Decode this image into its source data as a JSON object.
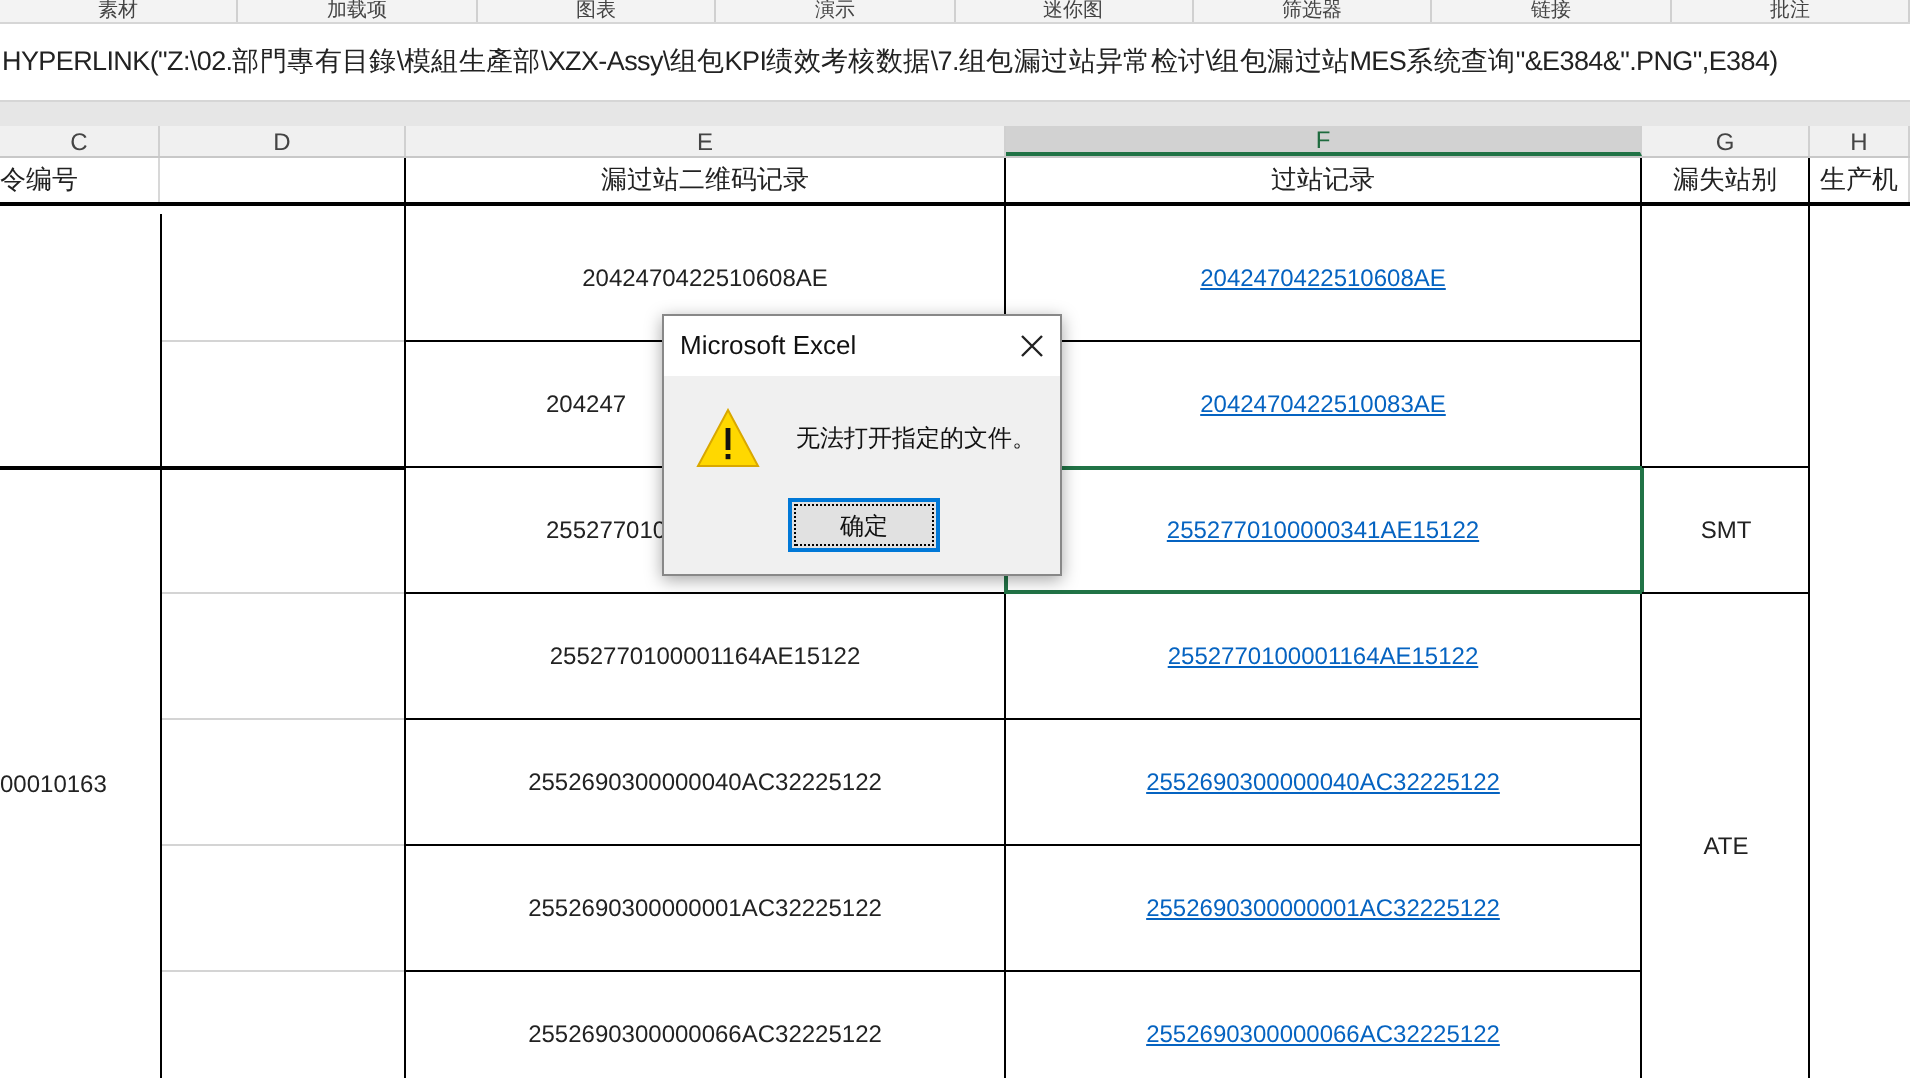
{
  "ribbon_groups": [
    "素材",
    "加载项",
    "图表",
    "演示",
    "迷你图",
    "筛选器",
    "链接",
    "批注"
  ],
  "formula_bar": {
    "value": "HYPERLINK(\"Z:\\02.部門專有目錄\\模組生產部\\XZX-Assy\\组包KPI绩效考核数据\\7.组包漏过站异常检讨\\组包漏过站MES系统查询\"&E384&\".PNG\",E384)"
  },
  "columns": [
    {
      "label": "C",
      "selected": false
    },
    {
      "label": "D",
      "selected": false
    },
    {
      "label": "E",
      "selected": false
    },
    {
      "label": "F",
      "selected": true
    },
    {
      "label": "G",
      "selected": false
    },
    {
      "label": "H",
      "selected": false
    }
  ],
  "header_row": {
    "c": "令编号",
    "e": "漏过站二维码记录",
    "f": "过站记录",
    "g": "漏失站别",
    "h": "生产机"
  },
  "rows": [
    {
      "e": "2042470422510608AE",
      "e_cut": false,
      "f": "2042470422510608AE",
      "selected": false
    },
    {
      "e": "204247",
      "e_cut": true,
      "f": "2042470422510083AE",
      "selected": false
    },
    {
      "e": "255277010",
      "e_cut": true,
      "f": "2552770100000341AE15122",
      "selected": true
    },
    {
      "e": "2552770100001164AE15122",
      "e_cut": false,
      "f": "2552770100001164AE15122",
      "selected": false
    },
    {
      "e": "2552690300000040AC32225122",
      "e_cut": false,
      "f": "2552690300000040AC32225122",
      "selected": false
    },
    {
      "e": "2552690300000001AC32225122",
      "e_cut": false,
      "f": "2552690300000001AC32225122",
      "selected": false
    },
    {
      "e": "2552690300000066AC32225122",
      "e_cut": false,
      "f": "2552690300000066AC32225122",
      "selected": false
    }
  ],
  "c_cell": "00010163",
  "g_cells": [
    "SMT",
    "ATE"
  ],
  "dialog": {
    "title": "Microsoft Excel",
    "message": "无法打开指定的文件。",
    "button": "确定"
  }
}
